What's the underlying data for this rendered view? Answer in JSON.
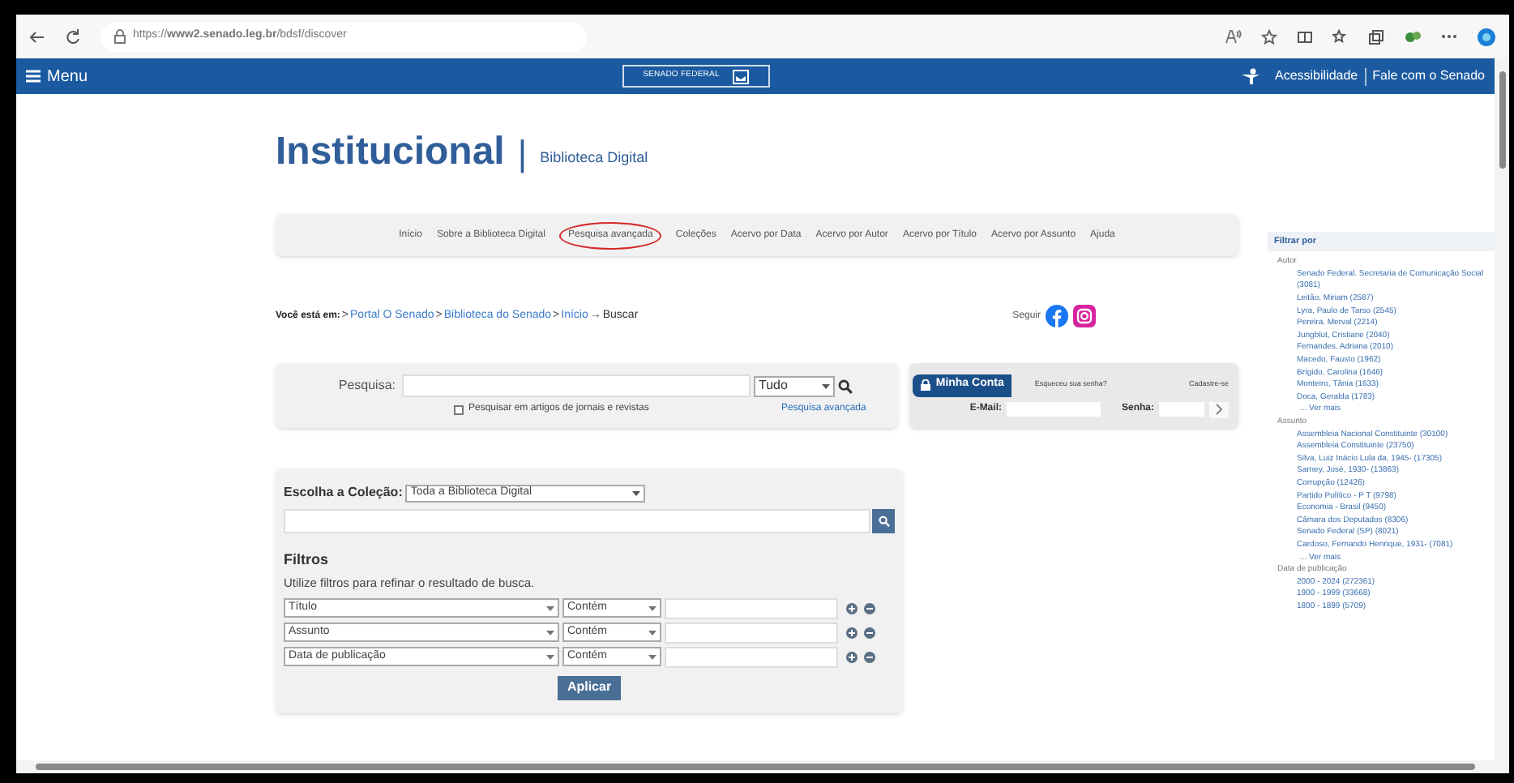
{
  "browser": {
    "url": "https://**www2.senado.leg.br**/bdsf/discover"
  },
  "header": {
    "menu_label": "Menu",
    "logo_text": "SENADO FEDERAL",
    "links": [
      "Acessibilidade",
      "Fale com o Senado"
    ]
  },
  "page_title": {
    "title": "Institucional",
    "separator": "|",
    "subtitle": "Biblioteca Digital"
  },
  "nav": [
    {
      "label": "Início",
      "highlighted": false
    },
    {
      "label": "Sobre a Biblioteca Digital",
      "highlighted": false
    },
    {
      "label": "Pesquisa avançada",
      "highlighted": true
    },
    {
      "label": "Coleções",
      "highlighted": false
    },
    {
      "label": "Acervo por Data",
      "highlighted": false
    },
    {
      "label": "Acervo por Autor",
      "highlighted": false
    },
    {
      "label": "Acervo por Título",
      "highlighted": false
    },
    {
      "label": "Acervo por Assunto",
      "highlighted": false
    },
    {
      "label": "Ajuda",
      "highlighted": false
    }
  ],
  "breadcrumb": {
    "prefix": "Você está em:",
    "items": [
      {
        "separator": ">",
        "label": "Portal O Senado",
        "link": true
      },
      {
        "separator": ">",
        "label": "Biblioteca do Senado",
        "link": true
      },
      {
        "separator": ">",
        "label": "Início",
        "link": true
      },
      {
        "separator": "→",
        "label": "Buscar",
        "link": false
      }
    ]
  },
  "social": {
    "label": "Seguir"
  },
  "search": {
    "label": "Pesquisa:",
    "scope": "Tudo",
    "option": {
      "label": "Pesquisar em artigos de jornais e revistas",
      "checked": false
    },
    "advanced_link": "Pesquisa avançada"
  },
  "account": {
    "title": "Minha Conta",
    "forgot": "Esqueceu sua senha?",
    "register": "Cadastre-se",
    "email_label": "E-Mail:",
    "password_label": "Senha:"
  },
  "collection": {
    "label": "Escolha a Coleção:",
    "value": "Toda a Biblioteca Digital",
    "filters_title": "Filtros",
    "filters_hint": "Utilize filtros para refinar o resultado de busca.",
    "filters": [
      {
        "field": "Título",
        "operator": "Contém"
      },
      {
        "field": "Assunto",
        "operator": "Contém"
      },
      {
        "field": "Data de publicação",
        "operator": "Contém"
      }
    ],
    "apply": "Aplicar"
  },
  "sidebar": {
    "title": "Filtrar por",
    "groups": [
      {
        "label": "Autor",
        "items": [
          "Senado Federal. Secretaria de Comunicação Social (3081)",
          "Leitão, Miriam (2587)",
          "Lyra, Paulo de Tarso (2545)",
          "Pereira, Merval (2214)",
          "Jungblut, Cristiane (2040)",
          "Fernandes, Adriana (2010)",
          "Macedo, Fausto (1962)",
          "Brígido, Carolina (1646)",
          "Monteiro, Tânia (1633)",
          "Doca, Geralda (1783)"
        ],
        "more": "... Ver mais"
      },
      {
        "label": "Assunto",
        "items": [
          "Assembleia Nacional Constituinte (30100)",
          "Assembleia Constituinte (23750)",
          "Silva, Luiz Inácio Lula da, 1945- (17305)",
          "Sarney, José, 1930- (13863)",
          "Corrupção (12426)",
          "Partido Político - P T (9798)",
          "Economia - Brasil (9450)",
          "Câmara dos Deputados (8306)",
          "Senado Federal (SP) (8021)",
          "Cardoso, Fernando Henrique, 1931- (7081)"
        ],
        "more": "... Ver mais"
      },
      {
        "label": "Data de publicação",
        "items": [
          "2000 - 2024 (272361)",
          "1900 - 1999 (33668)",
          "1800 - 1899 (5709)"
        ]
      }
    ]
  }
}
